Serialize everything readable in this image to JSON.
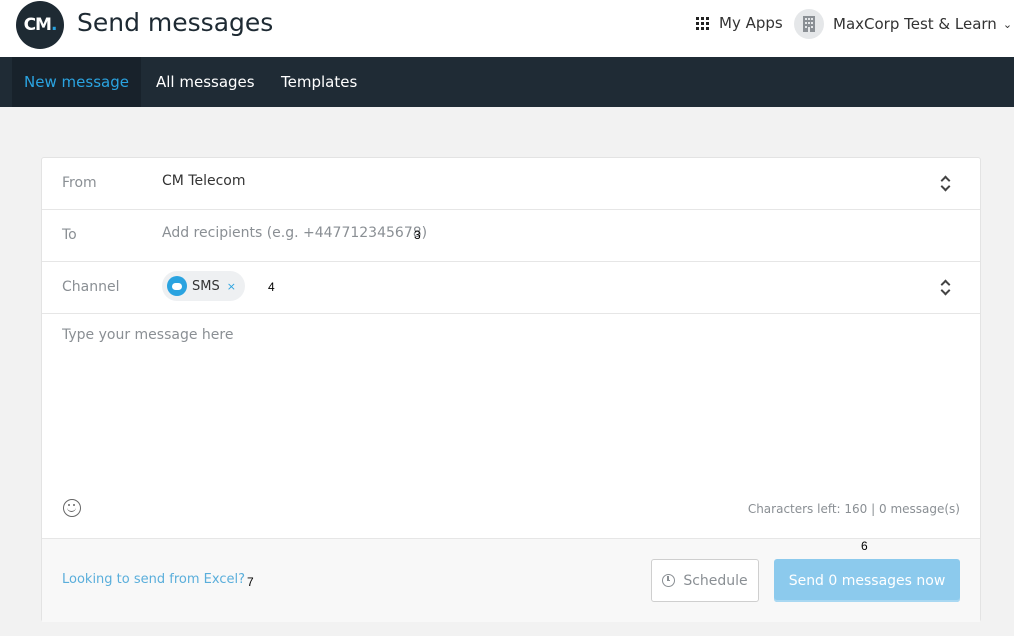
{
  "header": {
    "logo_text": "CM",
    "logo_dot": ".",
    "title": "Send messages",
    "my_apps_label": "My Apps",
    "account_label": "MaxCorp Test & Learn",
    "account_chevron": "⌄"
  },
  "nav": {
    "tabs": [
      {
        "label": "New message",
        "active": true
      },
      {
        "label": "All messages",
        "active": false
      },
      {
        "label": "Templates",
        "active": false
      }
    ]
  },
  "form": {
    "from_label": "From",
    "from_value": "CM Telecom",
    "to_label": "To",
    "to_placeholder": "Add recipients (e.g. +447712345678)",
    "channel_label": "Channel",
    "channel_chip": "SMS",
    "channel_chip_remove": "×",
    "message_placeholder": "Type your message here",
    "counter_text": "Characters left: 160 | 0 message(s)"
  },
  "footer": {
    "excel_link": "Looking to send from Excel?",
    "schedule_label": "Schedule",
    "send_label": "Send 0 messages now"
  },
  "markers": {
    "m3": "3",
    "m4": "4",
    "m6": "6",
    "m7": "7"
  },
  "colors": {
    "nav_bg": "#1f2b35",
    "accent": "#2aa3e0",
    "send_button": "#8ccaed"
  },
  "icons": [
    "grid-icon",
    "building-icon",
    "chevron-down-icon",
    "updown-icon",
    "chat-bubble-icon",
    "close-icon",
    "smiley-icon",
    "clock-icon"
  ]
}
